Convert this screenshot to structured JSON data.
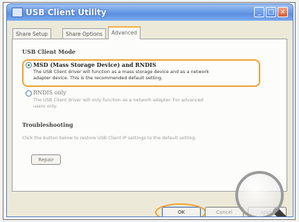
{
  "window": {
    "title": "USB Client Utility",
    "controls": {
      "minimize": "_",
      "maximize": "□",
      "close": "×"
    }
  },
  "tabs": [
    {
      "label": "Share Setup",
      "selected": false
    },
    {
      "label": "Share Options",
      "selected": false
    },
    {
      "label": "Advanced",
      "selected": true
    }
  ],
  "mode_section": {
    "heading": "USB Client Mode",
    "options": [
      {
        "label": "MSD (Mass Storage Device) and RNDIS",
        "checked": true,
        "description_line1": "The USB Client driver will function as a mass storage device and as a network",
        "description_line2": "adapter device. This is the recommended default setting."
      },
      {
        "label": "RNDIS only",
        "checked": false,
        "description_line1": "The USB Client driver will only function as a network adapter. For advanced",
        "description_line2": "users only."
      }
    ]
  },
  "troubleshooting": {
    "heading": "Troubleshooting",
    "text": "Click the button below to restore USB Client IP settings to the default setting.",
    "repair_label": "Repair"
  },
  "buttons": {
    "ok": "OK",
    "cancel": "Cancel",
    "apply": "Apply"
  },
  "colors": {
    "highlight": "#f0a030",
    "titlebar": "#5d8fe0"
  }
}
